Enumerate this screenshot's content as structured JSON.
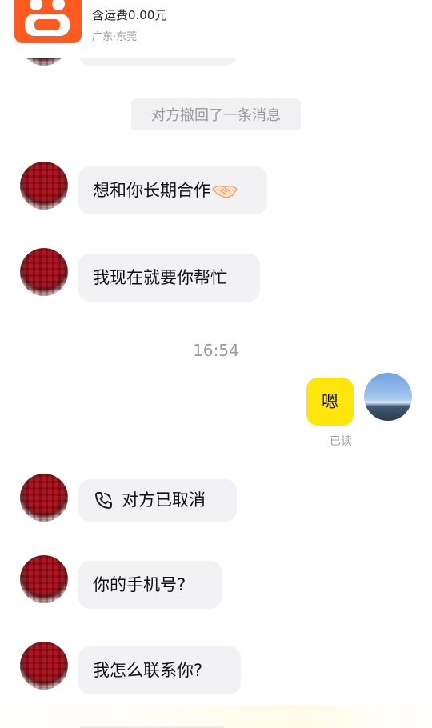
{
  "product": {
    "price_text": "含运费0.00元",
    "location": "广东·东莞",
    "brand_color": "#ff5a1f"
  },
  "system_message": "对方撤回了一条消息",
  "messages_before_time": [
    {
      "from": "other",
      "text": "想和你长期合作",
      "emoji": "handshake"
    },
    {
      "from": "other",
      "text": "我现在就要你帮忙"
    }
  ],
  "timestamp": "16:54",
  "self_message": {
    "text": "嗯",
    "status": "已读",
    "bubble_color": "#ffe60a"
  },
  "call_message": {
    "text": "对方已取消",
    "icon": "phone-icon"
  },
  "messages_after_call": [
    {
      "from": "other",
      "text": "你的手机号?"
    },
    {
      "from": "other",
      "text": "我怎么联系你?"
    }
  ]
}
